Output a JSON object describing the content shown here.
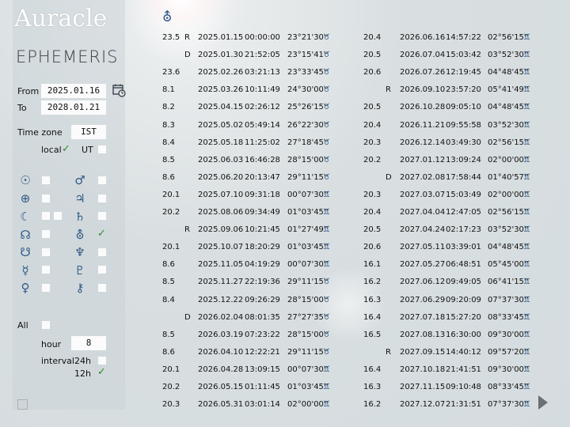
{
  "logo": {
    "main": "Auracle",
    "sub": "EPHEMERIS"
  },
  "sidebar": {
    "from_label": "From",
    "from_value": "2025.01.16",
    "to_label": "To",
    "to_value": "2028.01.21",
    "timezone_label": "Time zone",
    "timezone_value": "IST",
    "local_label": "local",
    "ut_label": "UT",
    "all_label": "All",
    "hour_label": "hour",
    "hour_value": "8",
    "interval_label": "interval",
    "opt_24h": "24h",
    "opt_12h": "12h",
    "planets_left": [
      "☉",
      "⊕",
      "☾",
      "☊",
      "☋",
      "☿",
      "♀"
    ],
    "planets_right": [
      "♂",
      "♃",
      "♄",
      "⛢",
      "♆",
      "♇",
      "⚷"
    ]
  },
  "header": {
    "selected_planet_icon": "⛢"
  },
  "table_left": [
    [
      "23.5",
      "R",
      "2025.01.15",
      "00:00:00",
      "23°21'30''",
      "♉"
    ],
    [
      "",
      "D",
      "2025.01.30",
      "21:52:05",
      "23°15'41''",
      "♉"
    ],
    [
      "23.6",
      "",
      "2025.02.26",
      "03:21:13",
      "23°33'45''",
      "♉"
    ],
    [
      "8.1",
      "",
      "2025.03.26",
      "10:11:49",
      "24°30'00''",
      "♉"
    ],
    [
      "8.2",
      "",
      "2025.04.15",
      "02:26:12",
      "25°26'15''",
      "♉"
    ],
    [
      "8.3",
      "",
      "2025.05.02",
      "05:49:14",
      "26°22'30''",
      "♉"
    ],
    [
      "8.4",
      "",
      "2025.05.18",
      "11:25:02",
      "27°18'45''",
      "♉"
    ],
    [
      "8.5",
      "",
      "2025.06.03",
      "16:46:28",
      "28°15'00''",
      "♉"
    ],
    [
      "8.6",
      "",
      "2025.06.20",
      "20:13:47",
      "29°11'15''",
      "♉"
    ],
    [
      "20.1",
      "",
      "2025.07.10",
      "09:31:18",
      "00°07'30''",
      "♊"
    ],
    [
      "20.2",
      "",
      "2025.08.06",
      "09:34:49",
      "01°03'45''",
      "♊"
    ],
    [
      "",
      "R",
      "2025.09.06",
      "10:21:45",
      "01°27'49''",
      "♊"
    ],
    [
      "20.1",
      "",
      "2025.10.07",
      "18:20:29",
      "01°03'45''",
      "♊"
    ],
    [
      "8.6",
      "",
      "2025.11.05",
      "04:19:29",
      "00°07'30''",
      "♊"
    ],
    [
      "8.5",
      "",
      "2025.11.27",
      "22:19:36",
      "29°11'15''",
      "♉"
    ],
    [
      "8.4",
      "",
      "2025.12.22",
      "09:26:29",
      "28°15'00''",
      "♉"
    ],
    [
      "",
      "D",
      "2026.02.04",
      "08:01:35",
      "27°27'35''",
      "♉"
    ],
    [
      "8.5",
      "",
      "2026.03.19",
      "07:23:22",
      "28°15'00''",
      "♉"
    ],
    [
      "8.6",
      "",
      "2026.04.10",
      "12:22:21",
      "29°11'15''",
      "♉"
    ],
    [
      "20.1",
      "",
      "2026.04.28",
      "13:09:15",
      "00°07'30''",
      "♊"
    ],
    [
      "20.2",
      "",
      "2026.05.15",
      "01:11:45",
      "01°03'45''",
      "♊"
    ],
    [
      "20.3",
      "",
      "2026.05.31",
      "03:01:14",
      "02°00'00''",
      "♊"
    ]
  ],
  "table_right": [
    [
      "20.4",
      "",
      "2026.06.16",
      "14:57:22",
      "02°56'15''",
      "♊"
    ],
    [
      "20.5",
      "",
      "2026.07.04",
      "15:03:42",
      "03°52'30''",
      "♊"
    ],
    [
      "20.6",
      "",
      "2026.07.26",
      "12:19:45",
      "04°48'45''",
      "♊"
    ],
    [
      "",
      "R",
      "2026.09.10",
      "23:57:20",
      "05°41'49''",
      "♊"
    ],
    [
      "20.5",
      "",
      "2026.10.28",
      "09:05:10",
      "04°48'45''",
      "♊"
    ],
    [
      "20.4",
      "",
      "2026.11.21",
      "09:55:58",
      "03°52'30''",
      "♊"
    ],
    [
      "20.3",
      "",
      "2026.12.14",
      "03:49:30",
      "02°56'15''",
      "♊"
    ],
    [
      "20.2",
      "",
      "2027.01.12",
      "13:09:24",
      "02°00'00''",
      "♊"
    ],
    [
      "",
      "D",
      "2027.02.08",
      "17:58:44",
      "01°40'57''",
      "♊"
    ],
    [
      "20.3",
      "",
      "2027.03.07",
      "15:03:49",
      "02°00'00''",
      "♊"
    ],
    [
      "20.4",
      "",
      "2027.04.04",
      "12:47:05",
      "02°56'15''",
      "♊"
    ],
    [
      "20.5",
      "",
      "2027.04.24",
      "02:17:23",
      "03°52'30''",
      "♊"
    ],
    [
      "20.6",
      "",
      "2027.05.11",
      "03:39:01",
      "04°48'45''",
      "♊"
    ],
    [
      "16.1",
      "",
      "2027.05.27",
      "06:48:51",
      "05°45'00''",
      "♊"
    ],
    [
      "16.2",
      "",
      "2027.06.12",
      "09:49:05",
      "06°41'15''",
      "♊"
    ],
    [
      "16.3",
      "",
      "2027.06.29",
      "09:20:09",
      "07°37'30''",
      "♊"
    ],
    [
      "16.4",
      "",
      "2027.07.18",
      "15:27:20",
      "08°33'45''",
      "♊"
    ],
    [
      "16.5",
      "",
      "2027.08.13",
      "16:30:00",
      "09°30'00''",
      "♊"
    ],
    [
      "",
      "R",
      "2027.09.15",
      "14:40:12",
      "09°57'20''",
      "♊"
    ],
    [
      "16.4",
      "",
      "2027.10.18",
      "21:41:51",
      "09°30'00''",
      "♊"
    ],
    [
      "16.3",
      "",
      "2027.11.15",
      "09:10:48",
      "08°33'45''",
      "♊"
    ],
    [
      "16.2",
      "",
      "2027.12.07",
      "21:31:51",
      "07°37'30''",
      "♊"
    ]
  ]
}
